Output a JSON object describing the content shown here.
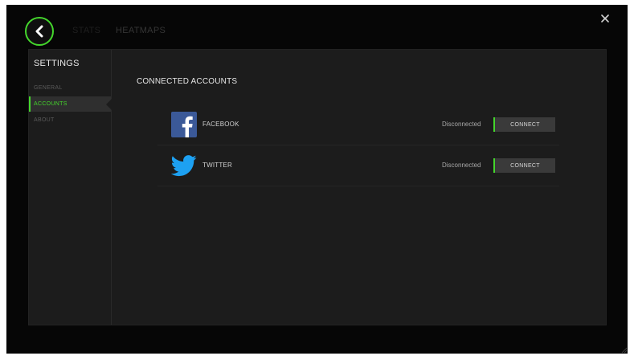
{
  "window": {
    "tabs": [
      {
        "label": "STATS"
      },
      {
        "label": "HEATMAPS"
      }
    ]
  },
  "settings": {
    "title": "SETTINGS",
    "sidebar": {
      "items": [
        {
          "label": "GENERAL",
          "selected": false
        },
        {
          "label": "ACCOUNTS",
          "selected": true
        },
        {
          "label": "ABOUT",
          "selected": false
        }
      ]
    },
    "content": {
      "title": "CONNECTED ACCOUNTS",
      "accounts": [
        {
          "name": "FACEBOOK",
          "icon": "facebook-icon",
          "status": "Disconnected",
          "action_label": "CONNECT"
        },
        {
          "name": "TWITTER",
          "icon": "twitter-icon",
          "status": "Disconnected",
          "action_label": "CONNECT"
        }
      ]
    }
  },
  "icons": {
    "back": "back-arrow-icon",
    "close": "close-icon"
  },
  "colors": {
    "accent": "#44d62c",
    "background": "#060606",
    "panel": "#1c1c1c",
    "facebook_blue": "#3b5998",
    "twitter_blue": "#1da1f2"
  }
}
